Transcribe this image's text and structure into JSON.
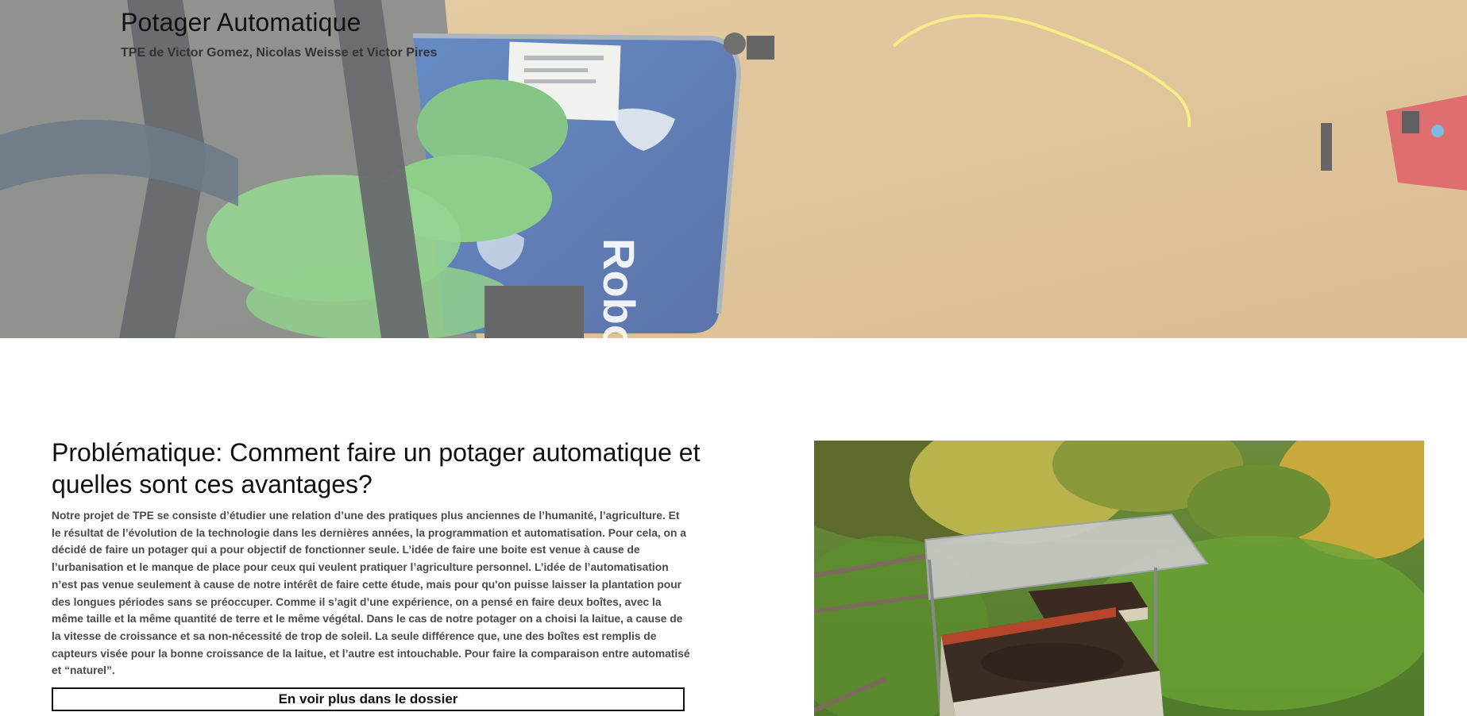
{
  "hero": {
    "title": "Potager Automatique",
    "subtitle": "TPE de Victor Gomez, Nicolas Weisse et Victor Pires",
    "image_icon": "robot-photo",
    "box_label": "Robot"
  },
  "main": {
    "heading": "Problématique: Comment faire un potager automatique et quelles sont ces avantages?",
    "paragraph": "Notre projet de TPE se consiste d’étudier une relation d’une des pratiques plus anciennes de l’humanité, l’agriculture. Et le résultat de l’évolution de la technologie dans les dernières années, la programmation et automatisation. Pour cela, on a décidé de faire un potager qui a pour objectif de fonctionner seule. L’idée de faire une boite est venue à cause de l’urbanisation et le manque de place pour ceux qui veulent pratiquer l’agriculture personnel. L’idée de l’automatisation n’est pas venue seulement à cause de notre intérêt de faire cette étude, mais pour qu'on puisse laisser la plantation pour des longues périodes sans se préoccuper. Comme il s’agit d’une expérience, on a pensé en faire deux boîtes, avec la même taille et la même quantité de terre et le même végétal. Dans le cas de notre potager on a choisi la laitue, a cause de la vitesse de croissance et sa non-nécessité de trop de soleil. La seule différence que, une des boîtes est remplis de capteurs visée pour la bonne croissance de la laitue, et l’autre est intouchable. Pour faire la comparaison entre automatisé et “naturel”.",
    "button_label": "En voir plus dans le dossier",
    "photo_icon": "garden-boxes-photo"
  }
}
